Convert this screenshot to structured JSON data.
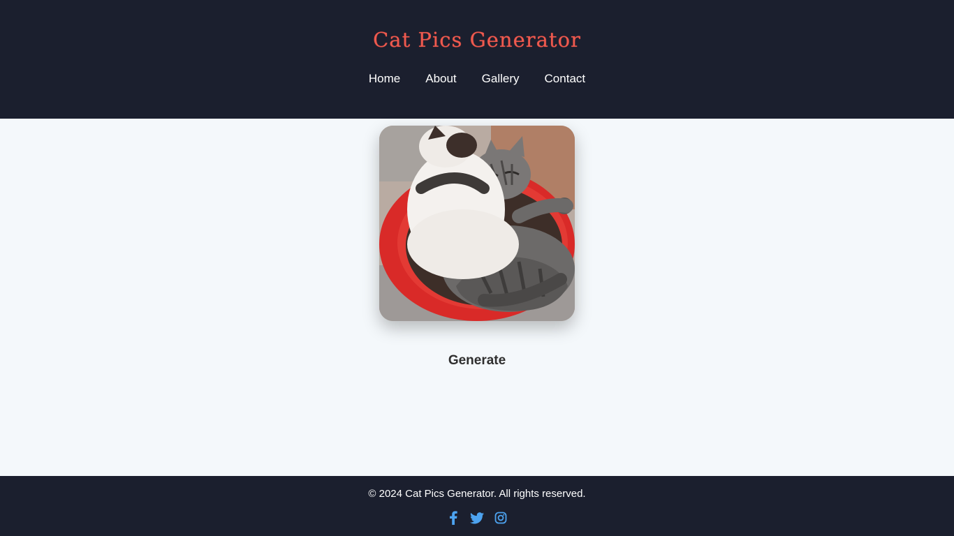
{
  "header": {
    "title": "Cat Pics Generator",
    "nav": [
      {
        "label": "Home"
      },
      {
        "label": "About"
      },
      {
        "label": "Gallery"
      },
      {
        "label": "Contact"
      }
    ]
  },
  "main": {
    "image_alt": "cat picture",
    "generate_label": "Generate"
  },
  "footer": {
    "copyright": "© 2024 Cat Pics Generator. All rights reserved.",
    "social": [
      {
        "icon": "facebook-icon"
      },
      {
        "icon": "twitter-icon"
      },
      {
        "icon": "instagram-icon"
      }
    ]
  },
  "colors": {
    "header_bg": "#1b1f2e",
    "title": "#ef5a4f",
    "page_bg": "#f4f8fb",
    "social_icon": "#4da3f0"
  }
}
